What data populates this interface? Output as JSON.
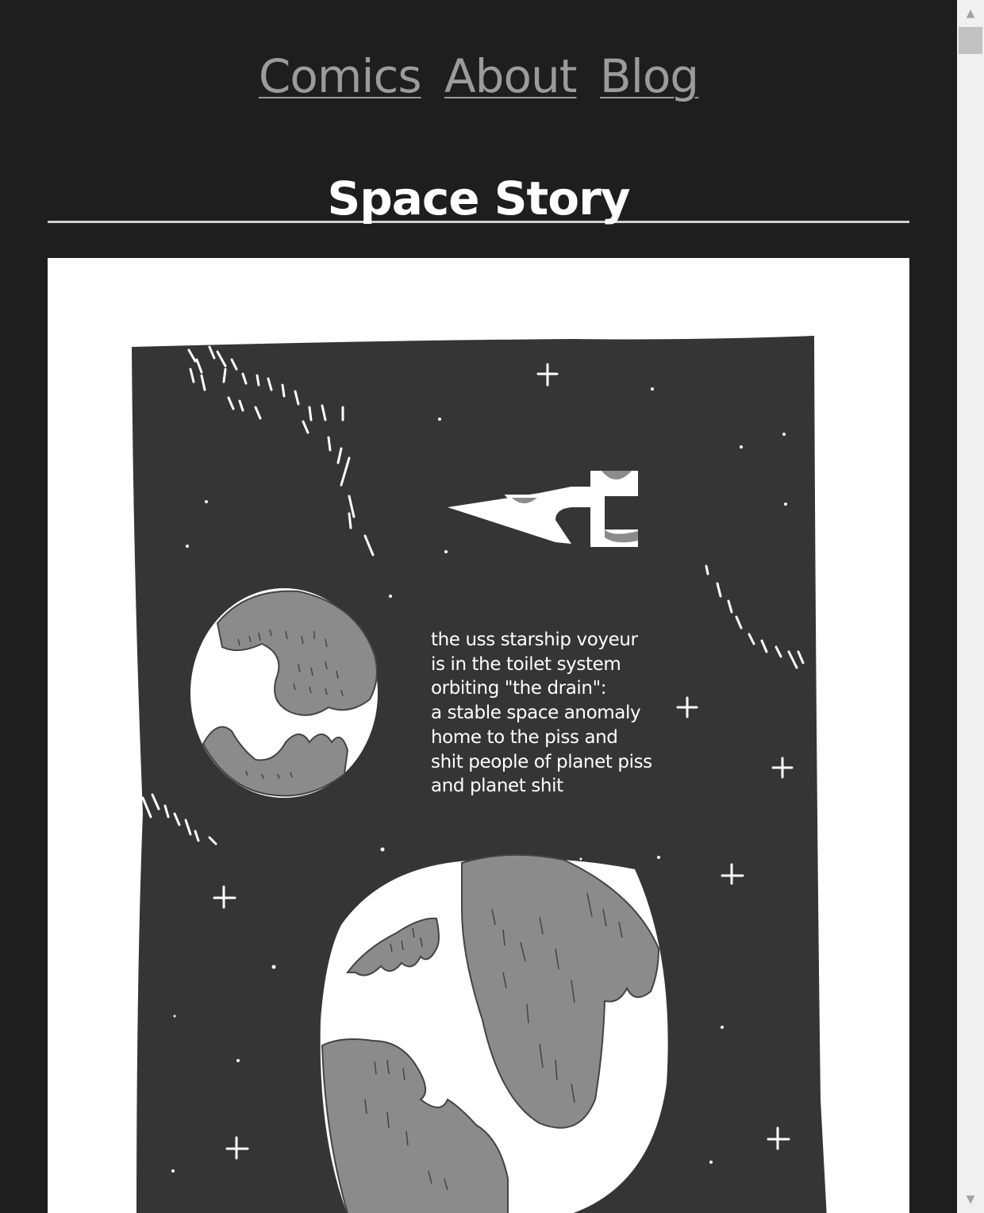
{
  "nav": {
    "comics": "Comics",
    "about": "About",
    "blog": "Blog"
  },
  "page": {
    "title": "Space Story"
  },
  "comic": {
    "caption": "the uss starship voyeur\nis in the toilet system\norbiting \"the drain\":\na stable space anomaly\nhome to the piss and\nshit people of planet piss\nand planet shit"
  },
  "colors": {
    "background": "#1e1e1e",
    "nav_link": "#9b9b9b",
    "title": "#ffffff",
    "space": "#353535",
    "planet_land": "#8b8b8b"
  },
  "scrollbar": {
    "up_icon": "▲",
    "down_icon": "▼"
  }
}
